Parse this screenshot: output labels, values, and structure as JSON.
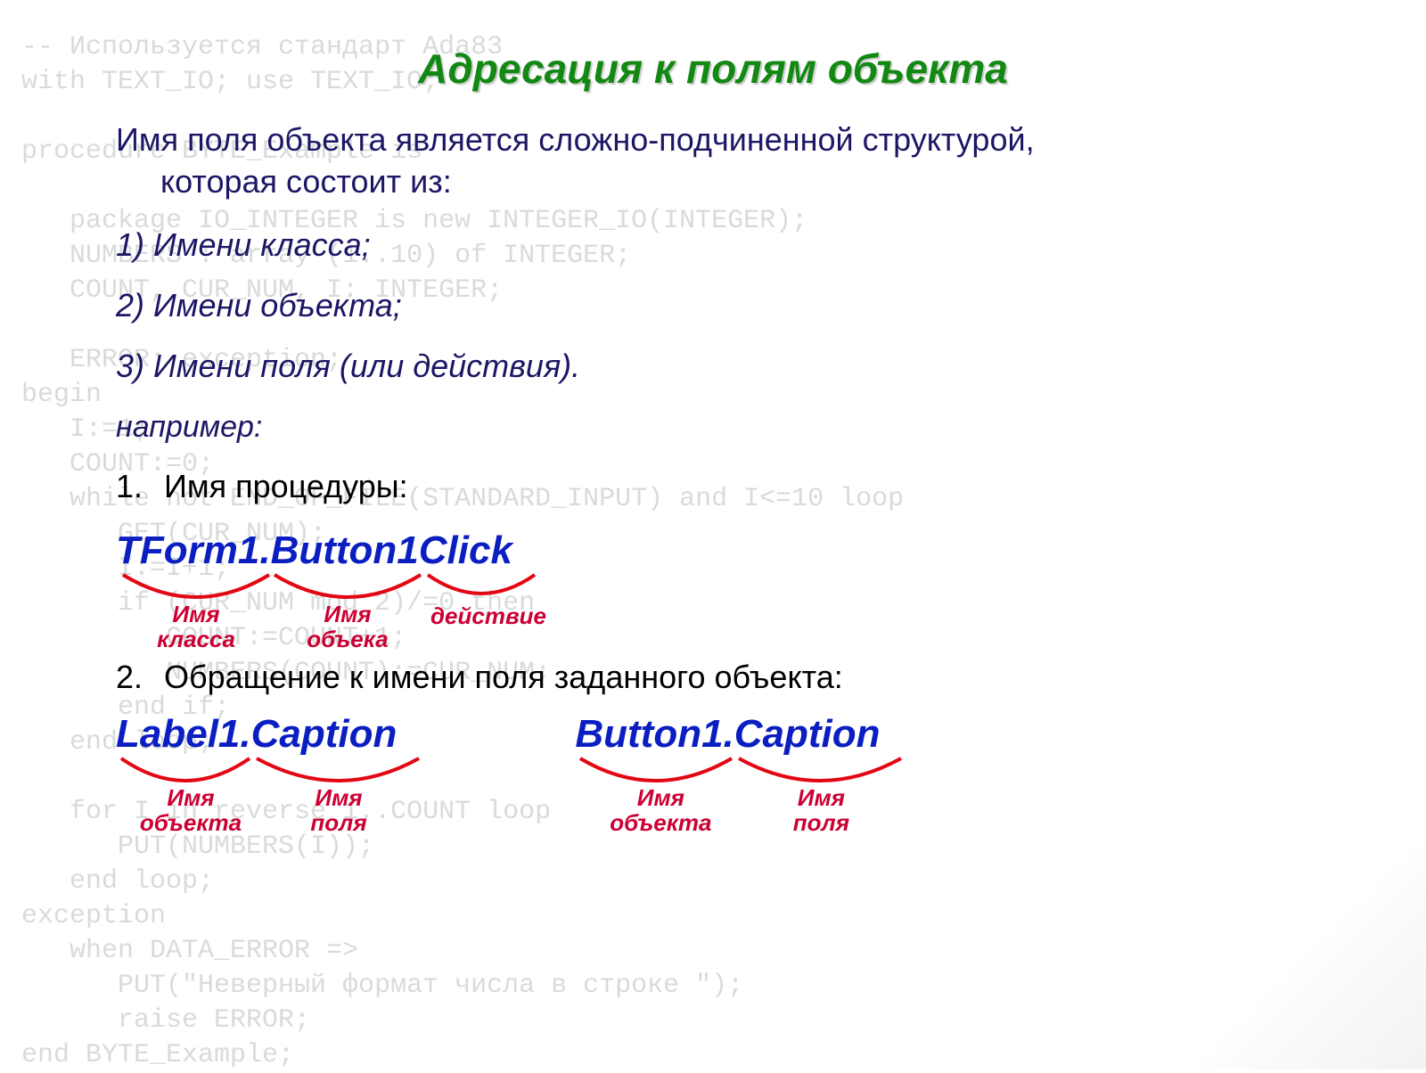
{
  "bg_code": "-- Используется стандарт Ada83\nwith TEXT_IO; use TEXT_IO;\n\nprocedure BYTE_Example is\n\n   package IO_INTEGER is new INTEGER_IO(INTEGER);\n   NUMBERS : array (1..10) of INTEGER;\n   COUNT, CUR_NUM, I: INTEGER;\n\n   ERROR: exception;\nbegin\n   I:=1;\n   COUNT:=0;\n   while not END_OF_FILE(STANDARD_INPUT) and I<=10 loop\n      GET(CUR_NUM);\n      I:=I+1;\n      if (CUR_NUM mod 2)/=0 then\n         COUNT:=COUNT+1;\n         NUMBERS(COUNT):=CUR_NUM;\n      end if;\n   end loop;\n\n   for I in reverse 1..COUNT loop\n      PUT(NUMBERS(I));\n   end loop;\nexception\n   when DATA_ERROR =>\n      PUT(\"Неверный формат числа в строке \");\n      raise ERROR;\nend BYTE_Example;",
  "title": "Адресация к полям объекта",
  "intro_line1": "Имя поля объекта является сложно-подчиненной структурой,",
  "intro_line2": "которая состоит из:",
  "list": {
    "i1": "1) Имени класса;",
    "i2": "2) Имени объекта;",
    "i3": "3) Имени поля (или действия)."
  },
  "example_label": "например:",
  "proc": {
    "num": "1.",
    "label": "Имя процедуры:",
    "code": "TForm1.Button1Click",
    "b1": "Имя\nкласса",
    "b2": "Имя\nобъека",
    "b3": "действие"
  },
  "field": {
    "num": "2.",
    "label": "Обращение к имени поля заданного объекта:",
    "left_code": "Label1.Caption",
    "right_code": "Button1.Caption",
    "lb1": "Имя\nобъекта",
    "lb2": "Имя\nполя",
    "rb1": "Имя\nобъекта",
    "rb2": "Имя\nполя"
  }
}
